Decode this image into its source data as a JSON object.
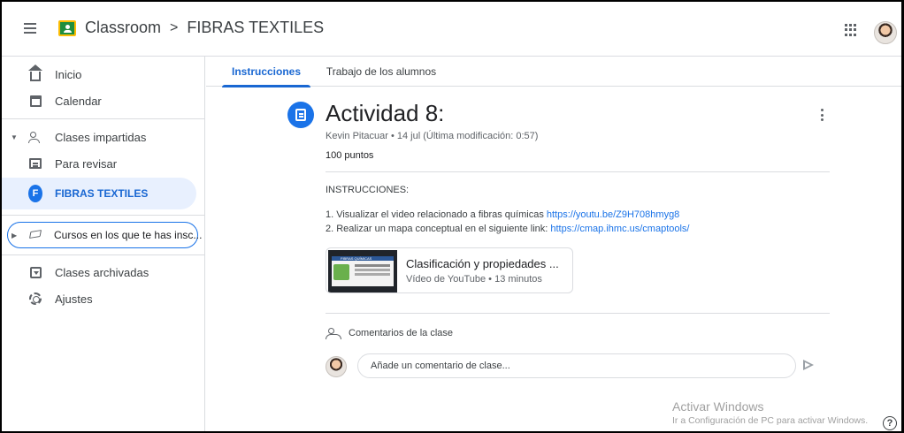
{
  "header": {
    "app_name": "Classroom",
    "separator": ">",
    "course_name": "FIBRAS TEXTILES"
  },
  "sidebar": {
    "items": [
      {
        "label": "Inicio",
        "icon": "home-icon"
      },
      {
        "label": "Calendar",
        "icon": "calendar-icon"
      },
      {
        "label": "Clases impartidas",
        "icon": "people-icon"
      },
      {
        "label": "Para revisar",
        "icon": "to-review-icon"
      },
      {
        "label": "FIBRAS TEXTILES",
        "badge": "F",
        "icon": "class-badge"
      },
      {
        "label": "Cursos en los que te has insc...",
        "icon": "graduation-cap-icon"
      },
      {
        "label": "Clases archivadas",
        "icon": "archive-icon"
      },
      {
        "label": "Ajustes",
        "icon": "gear-icon"
      }
    ]
  },
  "tabs": [
    {
      "label": "Instrucciones",
      "active": true
    },
    {
      "label": "Trabajo de los alumnos",
      "active": false
    }
  ],
  "post": {
    "title": "Actividad 8:",
    "meta": "Kevin Pitacuar • 14 jul (Última modificación: 0:57)",
    "points": "100 puntos",
    "instructions_heading": "INSTRUCCIONES:",
    "steps": [
      {
        "text": "1.   Visualizar el video relacionado a fibras químicas ",
        "link": "https://youtu.be/Z9H708hmyg8"
      },
      {
        "text": "2.   Realizar un mapa conceptual en el siguiente link: ",
        "link": "https://cmap.ihmc.us/cmaptools/"
      }
    ],
    "attachment": {
      "title": "Clasificación y propiedades ...",
      "subtitle": "Vídeo de YouTube • 13 minutos",
      "thumb_text": "FIBRAS QUÍMICAS"
    }
  },
  "comments": {
    "heading": "Comentarios de la clase",
    "placeholder": "Añade un comentario de clase..."
  },
  "watermark": {
    "title": "Activar Windows",
    "subtitle": "Ir a Configuración de PC para activar Windows."
  },
  "help": "?",
  "colors": {
    "accent": "#1967d2",
    "active_bg": "#e8f0fe",
    "icon_blue": "#1a73e8"
  }
}
